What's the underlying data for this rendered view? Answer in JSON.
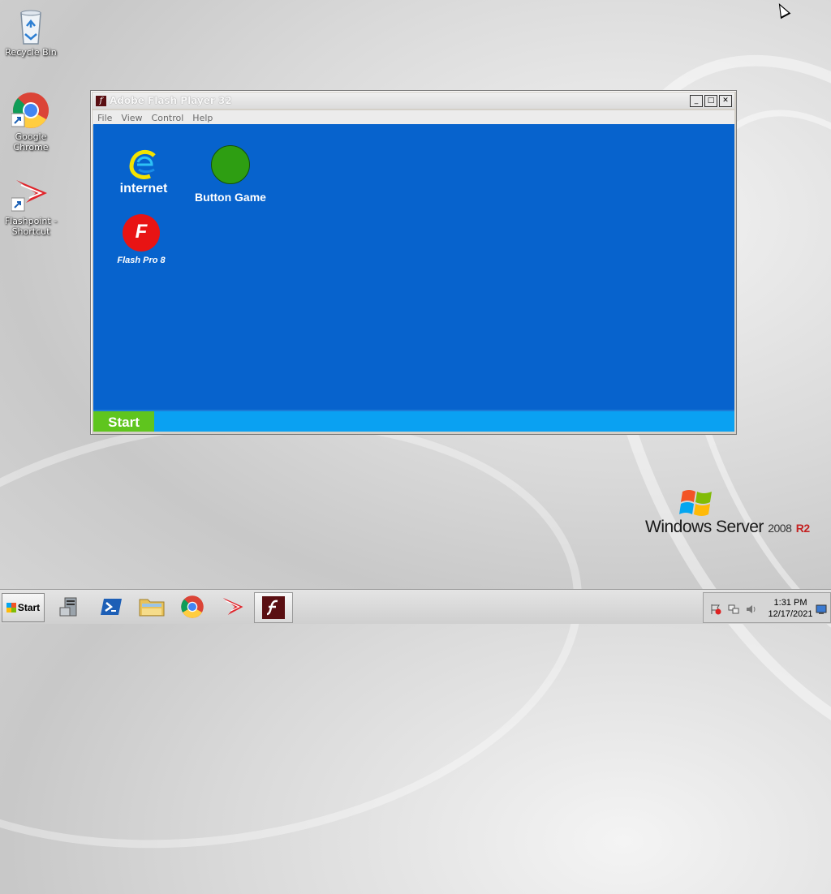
{
  "desktop": {
    "icons": [
      {
        "label": "Recycle Bin",
        "icon": "recycle-bin-icon"
      },
      {
        "label": "Google Chrome",
        "icon": "chrome-icon"
      },
      {
        "label": "Flashpoint - Shortcut",
        "icon": "flashpoint-icon"
      }
    ],
    "branding": {
      "windows": "Windows Server",
      "version": "2008",
      "release": "R2"
    }
  },
  "flash_window": {
    "title": "Adobe Flash Player 32",
    "menu": [
      "File",
      "View",
      "Control",
      "Help"
    ],
    "controls": {
      "minimize": "_",
      "maximize": "□",
      "close": "✕"
    },
    "stage": {
      "background": "#0763cd",
      "apps": [
        {
          "label": "internet",
          "icon": "internet-e-icon"
        },
        {
          "label": "Button Game",
          "icon": "green-circle-icon"
        },
        {
          "label": "Flash Pro 8",
          "icon": "flash-pro-icon",
          "glyph": "F"
        }
      ],
      "taskbar": {
        "start_label": "Start",
        "start_color": "#5fc51e",
        "bar_color": "#0aa1f2"
      }
    }
  },
  "taskbar": {
    "start_label": "Start",
    "items": [
      "server-manager-icon",
      "powershell-icon",
      "explorer-icon",
      "chrome-icon",
      "flashpoint-icon",
      "flash-player-icon"
    ],
    "clock": {
      "time": "1:31 PM",
      "date": "12/17/2021"
    }
  }
}
